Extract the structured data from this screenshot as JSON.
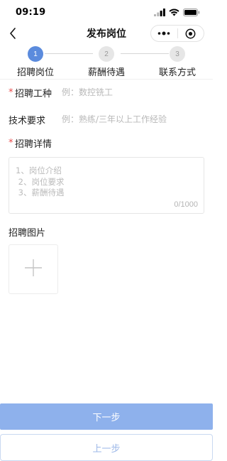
{
  "status_bar": {
    "time": "09:19"
  },
  "nav": {
    "title": "发布岗位"
  },
  "steps": [
    {
      "number": "1",
      "label": "招聘岗位",
      "state": "active"
    },
    {
      "number": "2",
      "label": "薪酬待遇",
      "state": "inactive"
    },
    {
      "number": "3",
      "label": "联系方式",
      "state": "inactive"
    }
  ],
  "form": {
    "job_type": {
      "label": "招聘工种",
      "required": true,
      "placeholder": "例：数控铣工",
      "value": ""
    },
    "skill": {
      "label": "技术要求",
      "required": false,
      "placeholder": "例：熟练/三年以上工作经验",
      "value": ""
    },
    "details": {
      "label": "招聘详情",
      "required": true,
      "placeholder": "1、岗位介绍\n 2、岗位要求\n 3、薪酬待遇",
      "counter": "0/1000"
    },
    "images": {
      "label": "招聘图片"
    }
  },
  "buttons": {
    "next": "下一步",
    "prev": "上一步"
  },
  "colors": {
    "accent": "#5b8bdd",
    "next_button": "#8eb1ec",
    "required_star": "#e84a4a",
    "placeholder": "#b8b8b8"
  },
  "icons": {
    "back": "chevron-left-icon",
    "more": "more-dots-icon",
    "close": "target-circle-icon",
    "upload": "plus-icon",
    "signal": "signal-icon",
    "wifi": "wifi-icon",
    "battery": "battery-icon"
  }
}
